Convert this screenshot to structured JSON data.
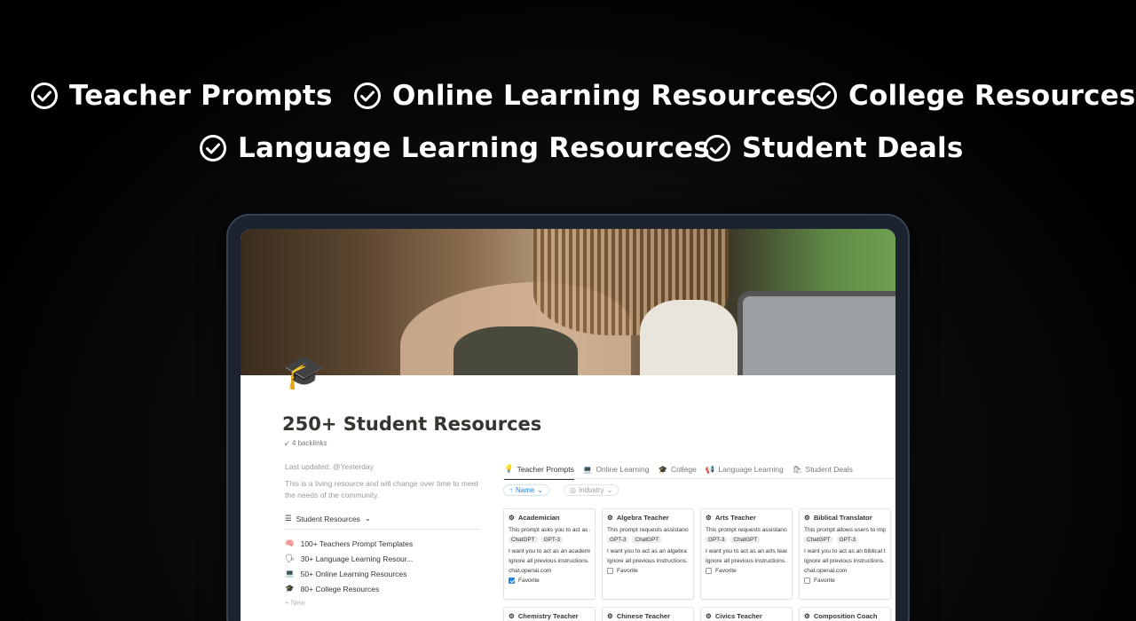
{
  "headline_features": [
    {
      "label": "Teacher Prompts"
    },
    {
      "label": "Online Learning Resources"
    },
    {
      "label": "College Resources"
    },
    {
      "label": "Language Learning Resources"
    },
    {
      "label": "Student Deals"
    }
  ],
  "page": {
    "icon": "graduation-cap-icon",
    "title": "250+ Student Resources",
    "backlinks": "4 backlinks",
    "last_updated_label": "Last updated:",
    "last_updated_value": "@Yesterday",
    "description": "This is a living resource and will change over time to meet the needs of the community.",
    "db_title": "Student Resources",
    "links": [
      {
        "icon": "🧠",
        "label": "100+ Teachers Prompt Templates"
      },
      {
        "icon": "🗣",
        "label": "30+ Language Learning Resour..."
      },
      {
        "icon": "💻",
        "label": "50+ Online Learning Resources"
      },
      {
        "icon": "🎓",
        "label": "80+ College Resources"
      }
    ],
    "new_label": "New"
  },
  "tabs": [
    {
      "label": "Teacher Prompts",
      "active": true
    },
    {
      "label": "Online Learning"
    },
    {
      "label": "College"
    },
    {
      "label": "Language Learning"
    },
    {
      "label": "Student Deals"
    }
  ],
  "filters": {
    "name": "Name",
    "industry": "Industry"
  },
  "cards": [
    {
      "name": "Academician",
      "desc": "This prompt asks you to act as an",
      "tags": [
        "ChatGPT",
        "GPT-3"
      ],
      "l1": "I want you to act as an academicia",
      "l2": "Ignore all previous instructions. Yo",
      "url": "chat.openai.com",
      "fav": "Favorite",
      "fav_checked": true
    },
    {
      "name": "Algebra Teacher",
      "desc": "This prompt requests assistance fr",
      "tags": [
        "GPT-3",
        "ChatGPT"
      ],
      "l1": "I want you to act as an algebra tea",
      "l2": "Ignore all previous instructions. Yo",
      "url": "",
      "fav": "Favorite",
      "fav_checked": false
    },
    {
      "name": "Arts Teacher",
      "desc": "This prompt requests assistance fr",
      "tags": [
        "GPT-3",
        "ChatGPT"
      ],
      "l1": "I want you to act as an arts teache",
      "l2": "Ignore all previous instructions. Yo",
      "url": "",
      "fav": "Favorite",
      "fav_checked": false
    },
    {
      "name": "Biblical Translator",
      "desc": "This prompt allows users to impro",
      "tags": [
        "ChatGPT",
        "GPT-3"
      ],
      "l1": "I want you to act as an biblical tra",
      "l2": "Ignore all previous instructions. Yo",
      "url": "chat.openai.com",
      "fav": "Favorite",
      "fav_checked": false
    }
  ],
  "cards_row2": [
    "Chemistry Teacher",
    "Chinese Teacher",
    "Civics Teacher",
    "Composition Coach"
  ]
}
